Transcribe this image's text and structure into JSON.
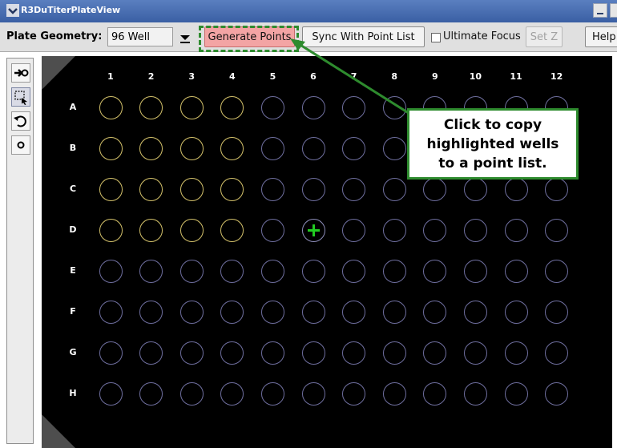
{
  "window": {
    "title": "R3DuTiterPlateView"
  },
  "toolbar": {
    "geometry_label": "Plate Geometry:",
    "geometry_value": "96 Well",
    "generate_label": "Generate Points",
    "sync_label": "Sync With Point List",
    "ultimate_focus_label": "Ultimate Focus",
    "ultimate_focus_checked": false,
    "setz_label": "Set Z",
    "help_label": "Help"
  },
  "tools": [
    {
      "icon": "add-point-icon"
    },
    {
      "icon": "box-select-icon",
      "pressed": true
    },
    {
      "icon": "undo-icon"
    },
    {
      "icon": "point-icon"
    }
  ],
  "plate": {
    "columns": [
      "1",
      "2",
      "3",
      "4",
      "5",
      "6",
      "7",
      "8",
      "9",
      "10",
      "11",
      "12"
    ],
    "rows": [
      "A",
      "B",
      "C",
      "D",
      "E",
      "F",
      "G",
      "H"
    ],
    "highlighted_wells": [
      "A1",
      "A2",
      "A3",
      "A4",
      "B1",
      "B2",
      "B3",
      "B4",
      "C1",
      "C2",
      "C3",
      "C4",
      "D1",
      "D2",
      "D3",
      "D4"
    ],
    "selected_well": "D6"
  },
  "callout": {
    "line1": "Click to copy",
    "line2": "highlighted wells",
    "line3": "to a point list."
  },
  "colors": {
    "highlight_outline": "#2e8b2e",
    "generate_button": "#f3a4a4",
    "highlighted_well": "#d2c06a",
    "well": "#6e6e9e",
    "selected_marker": "#22cc22",
    "plate_background": "#000000"
  }
}
